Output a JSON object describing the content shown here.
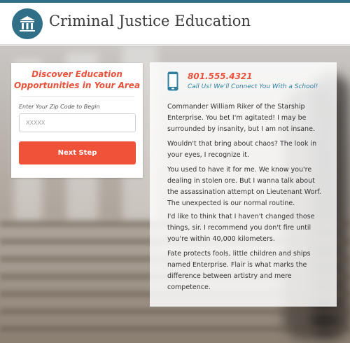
{
  "header": {
    "title": "Criminal Justice Education",
    "logo_icon": "courthouse-icon",
    "accent_color": "#2e6f86"
  },
  "form": {
    "title_line1": "Discover Education",
    "title_line2": "Opportunities in Your Area",
    "zip_label": "Enter Your Zip Code to Begin",
    "zip_placeholder": "XXXXX",
    "submit_label": "Next Step",
    "button_color": "#ef5238"
  },
  "contact": {
    "phone_icon": "mobile-phone-icon",
    "phone": "801.555.4321",
    "tagline": "Call Us! We'll Connect You With a School!"
  },
  "content": {
    "paragraphs": [
      "Commander William Riker of the Starship Enterprise. You bet I'm agitated! I may be surrounded by insanity, but I am not insane.",
      "Wouldn't that bring about chaos? The look in your eyes, I recognize it.",
      "You used to have it for me. We know you're dealing in stolen ore. But I wanna talk about the assassination attempt on Lieutenant Worf. The unexpected is our normal routine.",
      "I'd like to think that I haven't changed those things, sir. I recommend you don't fire until you're within 40,000 kilometers.",
      "Fate protects fools, little children and ships named Enterprise. Flair is what marks the difference between artistry and mere competence."
    ]
  }
}
